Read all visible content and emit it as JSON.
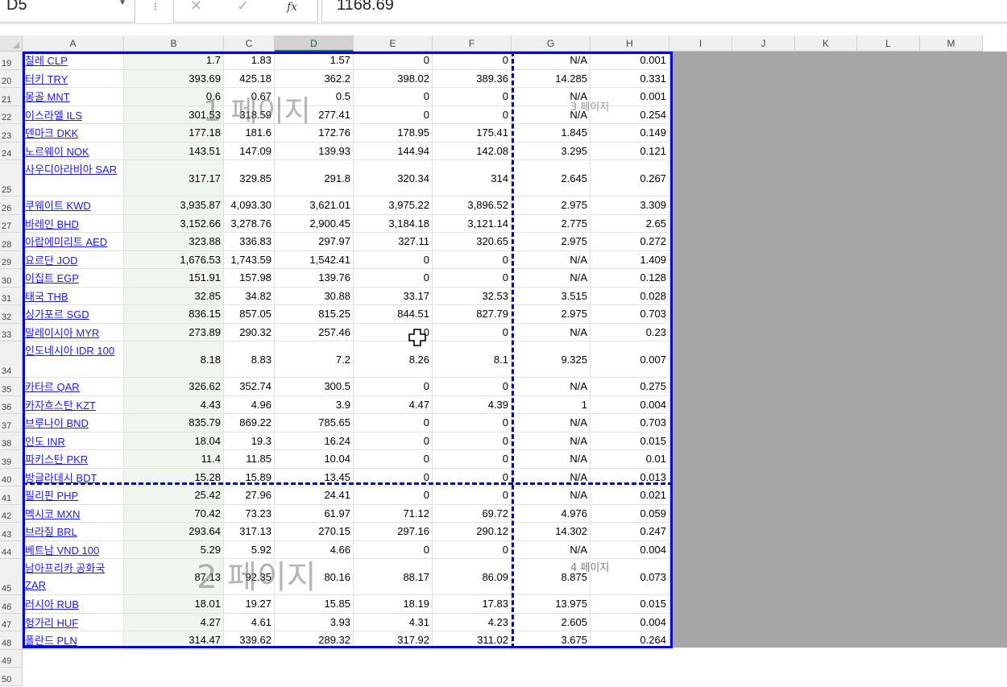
{
  "formula_bar": {
    "name_box": "D5",
    "dots": "⁝",
    "cancel": "✕",
    "enter": "✓",
    "fx": "fx",
    "value": "1168.69"
  },
  "columns": [
    "A",
    "B",
    "C",
    "D",
    "E",
    "F",
    "G",
    "H",
    "I",
    "J",
    "K",
    "L",
    "M"
  ],
  "active_column": "D",
  "rows": [
    {
      "num": "19",
      "a": "칠레 CLP",
      "b": "1.7",
      "c": "1.83",
      "d": "1.57",
      "e": "0",
      "f": "0",
      "g": "N/A",
      "h": "0.001"
    },
    {
      "num": "20",
      "a": "터키 TRY",
      "b": "393.69",
      "c": "425.18",
      "d": "362.2",
      "e": "398.02",
      "f": "389.36",
      "g": "14.285",
      "h": "0.331"
    },
    {
      "num": "21",
      "a": "몽골 MNT",
      "b": "0.6",
      "c": "0.67",
      "d": "0.5",
      "e": "0",
      "f": "0",
      "g": "N/A",
      "h": "0.001"
    },
    {
      "num": "22",
      "a": "이스라엘 ILS",
      "b": "301.53",
      "c": "318.59",
      "d": "277.41",
      "e": "0",
      "f": "0",
      "g": "N/A",
      "h": "0.254"
    },
    {
      "num": "23",
      "a": "덴마크 DKK",
      "b": "177.18",
      "c": "181.6",
      "d": "172.76",
      "e": "178.95",
      "f": "175.41",
      "g": "1.845",
      "h": "0.149"
    },
    {
      "num": "24",
      "a": "노르웨이 NOK",
      "b": "143.51",
      "c": "147.09",
      "d": "139.93",
      "e": "144.94",
      "f": "142.08",
      "g": "3.295",
      "h": "0.121"
    },
    {
      "num": "25",
      "a": "사우디아라비아 SAR",
      "b": "317.17",
      "c": "329.85",
      "d": "291.8",
      "e": "320.34",
      "f": "314",
      "g": "2.645",
      "h": "0.267",
      "tall": true
    },
    {
      "num": "26",
      "a": "쿠웨이트 KWD",
      "b": "3,935.87",
      "c": "4,093.30",
      "d": "3,621.01",
      "e": "3,975.22",
      "f": "3,896.52",
      "g": "2.975",
      "h": "3.309"
    },
    {
      "num": "27",
      "a": "바레인 BHD",
      "b": "3,152.66",
      "c": "3,278.76",
      "d": "2,900.45",
      "e": "3,184.18",
      "f": "3,121.14",
      "g": "2.775",
      "h": "2.65"
    },
    {
      "num": "28",
      "a": "아랍에미리트 AED",
      "b": "323.88",
      "c": "336.83",
      "d": "297.97",
      "e": "327.11",
      "f": "320.65",
      "g": "2.975",
      "h": "0.272"
    },
    {
      "num": "29",
      "a": "요르단 JOD",
      "b": "1,676.53",
      "c": "1,743.59",
      "d": "1,542.41",
      "e": "0",
      "f": "0",
      "g": "N/A",
      "h": "1.409"
    },
    {
      "num": "30",
      "a": "이집트 EGP",
      "b": "151.91",
      "c": "157.98",
      "d": "139.76",
      "e": "0",
      "f": "0",
      "g": "N/A",
      "h": "0.128"
    },
    {
      "num": "31",
      "a": "태국 THB",
      "b": "32.85",
      "c": "34.82",
      "d": "30.88",
      "e": "33.17",
      "f": "32.53",
      "g": "3.515",
      "h": "0.028"
    },
    {
      "num": "32",
      "a": "싱가포르 SGD",
      "b": "836.15",
      "c": "857.05",
      "d": "815.25",
      "e": "844.51",
      "f": "827.79",
      "g": "2.975",
      "h": "0.703"
    },
    {
      "num": "33",
      "a": "말레이시아 MYR",
      "b": "273.89",
      "c": "290.32",
      "d": "257.46",
      "e": "0",
      "f": "0",
      "g": "N/A",
      "h": "0.23"
    },
    {
      "num": "34",
      "a": "인도네시아 IDR 100",
      "b": "8.18",
      "c": "8.83",
      "d": "7.2",
      "e": "8.26",
      "f": "8.1",
      "g": "9.325",
      "h": "0.007",
      "tall": true
    },
    {
      "num": "35",
      "a": "카타르 QAR",
      "b": "326.62",
      "c": "352.74",
      "d": "300.5",
      "e": "0",
      "f": "0",
      "g": "N/A",
      "h": "0.275"
    },
    {
      "num": "36",
      "a": "카자흐스탄 KZT",
      "b": "4.43",
      "c": "4.96",
      "d": "3.9",
      "e": "4.47",
      "f": "4.39",
      "g": "1",
      "h": "0.004"
    },
    {
      "num": "37",
      "a": "브루나이 BND",
      "b": "835.79",
      "c": "869.22",
      "d": "785.65",
      "e": "0",
      "f": "0",
      "g": "N/A",
      "h": "0.703"
    },
    {
      "num": "38",
      "a": "인도 INR",
      "b": "18.04",
      "c": "19.3",
      "d": "16.24",
      "e": "0",
      "f": "0",
      "g": "N/A",
      "h": "0.015"
    },
    {
      "num": "39",
      "a": "파키스탄 PKR",
      "b": "11.4",
      "c": "11.85",
      "d": "10.04",
      "e": "0",
      "f": "0",
      "g": "N/A",
      "h": "0.01"
    },
    {
      "num": "40",
      "a": "방글라데시 BDT",
      "b": "15.28",
      "c": "15.89",
      "d": "13.45",
      "e": "0",
      "f": "0",
      "g": "N/A",
      "h": "0.013"
    },
    {
      "num": "41",
      "a": "필리핀 PHP",
      "b": "25.42",
      "c": "27.96",
      "d": "24.41",
      "e": "0",
      "f": "0",
      "g": "N/A",
      "h": "0.021"
    },
    {
      "num": "42",
      "a": "멕시코 MXN",
      "b": "70.42",
      "c": "73.23",
      "d": "61.97",
      "e": "71.12",
      "f": "69.72",
      "g": "4.976",
      "h": "0.059"
    },
    {
      "num": "43",
      "a": "브라질 BRL",
      "b": "293.64",
      "c": "317.13",
      "d": "270.15",
      "e": "297.16",
      "f": "290.12",
      "g": "14.302",
      "h": "0.247"
    },
    {
      "num": "44",
      "a": "베트남 VND 100",
      "b": "5.29",
      "c": "5.92",
      "d": "4.66",
      "e": "0",
      "f": "0",
      "g": "N/A",
      "h": "0.004"
    },
    {
      "num": "45",
      "a": "남아프리카 공화국 ZAR",
      "b": "87.13",
      "c": "92.35",
      "d": "80.16",
      "e": "88.17",
      "f": "86.09",
      "g": "8.875",
      "h": "0.073",
      "tall": true
    },
    {
      "num": "46",
      "a": "러시아 RUB",
      "b": "18.01",
      "c": "19.27",
      "d": "15.85",
      "e": "18.19",
      "f": "17.83",
      "g": "13.975",
      "h": "0.015"
    },
    {
      "num": "47",
      "a": "헝가리 HUF",
      "b": "4.27",
      "c": "4.61",
      "d": "3.93",
      "e": "4.31",
      "f": "4.23",
      "g": "2.605",
      "h": "0.004"
    },
    {
      "num": "48",
      "a": "폴란드 PLN",
      "b": "314.47",
      "c": "339.62",
      "d": "289.32",
      "e": "317.92",
      "f": "311.02",
      "g": "3.675",
      "h": "0.264"
    }
  ],
  "extra_rows": [
    "49",
    "50"
  ],
  "watermarks": {
    "page1": "1 페이지",
    "page2": "2 페이지",
    "page3": "3 페이지",
    "page4": "4 페이지"
  },
  "colors": {
    "page_break": "#0000cc",
    "link_text": "#1a1aff",
    "selected_column_fill": "#eef6ee",
    "outside_print_area": "#a6a6a6"
  }
}
